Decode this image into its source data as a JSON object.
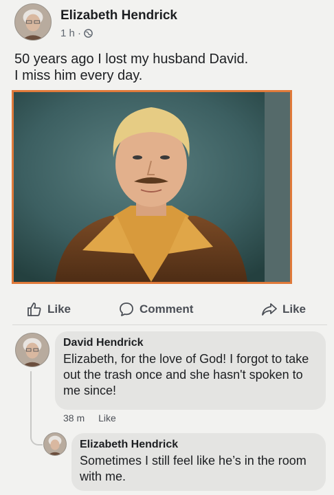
{
  "post": {
    "author": "Elizabeth Hendrick",
    "time": "1 h ·",
    "text_line1": "50 years ago I lost my husband David.",
    "text_line2": "I miss him every day."
  },
  "actions": {
    "like": "Like",
    "comment": "Comment",
    "share": "Like"
  },
  "comments": [
    {
      "author": "David Hendrick",
      "text": "Elizabeth, for the love of God! I forgot to take out the trash once and she hasn't spoken to me since!",
      "time": "38 m",
      "like": "Like"
    },
    {
      "author": "Elizabeth Hendrick",
      "text": "Sometimes I still feel like he’s in the room with me."
    }
  ],
  "colors": {
    "photo_border": "#e07a3a",
    "bubble": "#e4e4e2",
    "background": "#f2f2f0"
  }
}
